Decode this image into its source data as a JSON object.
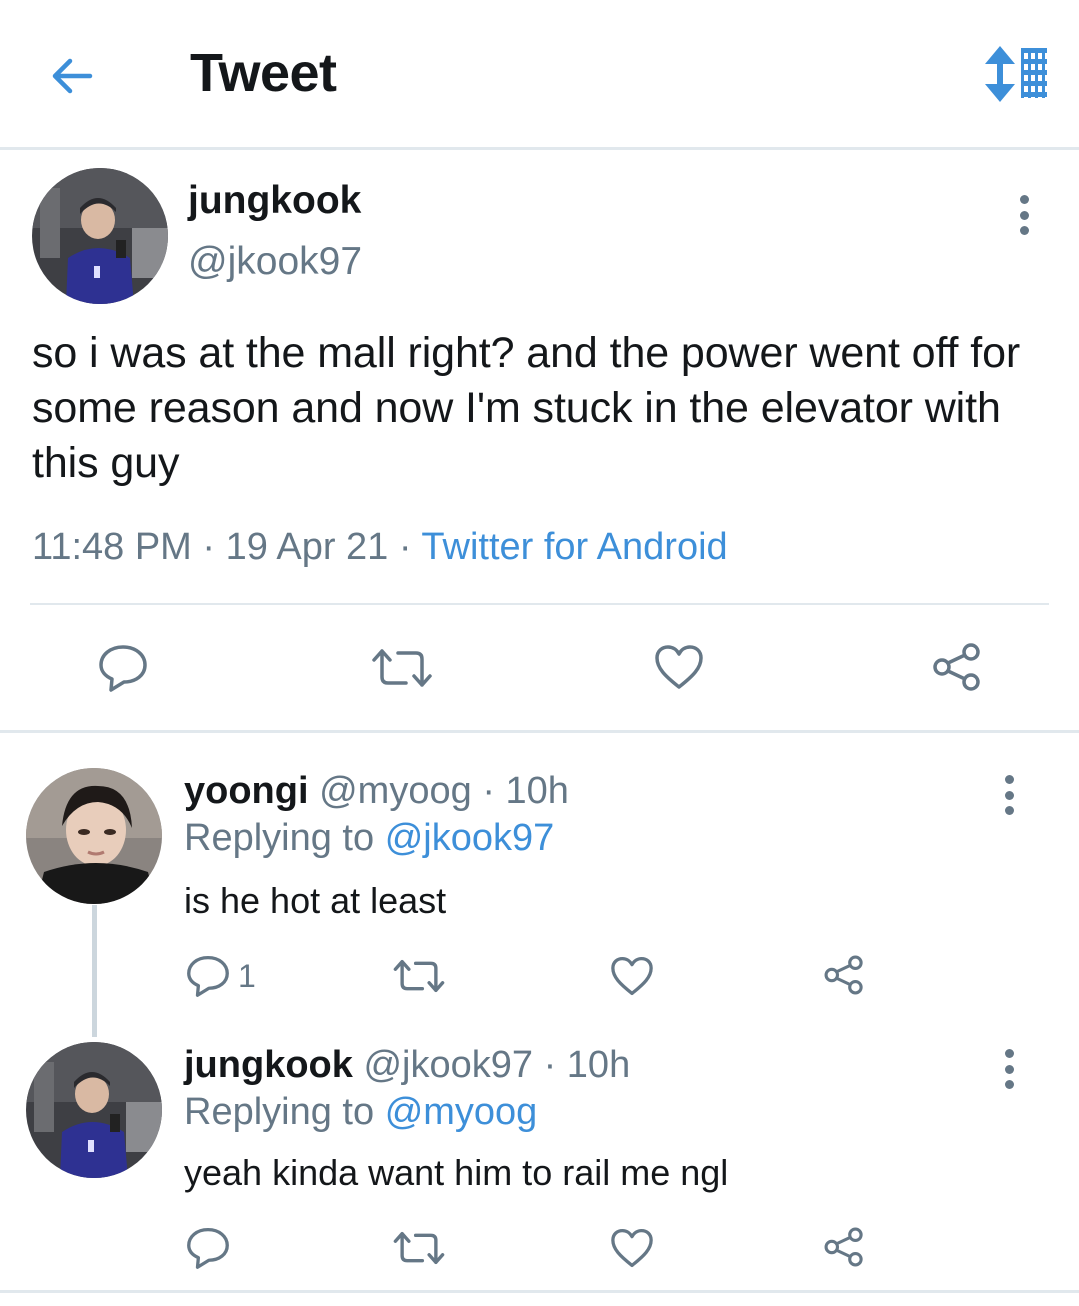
{
  "header": {
    "title": "Tweet",
    "back_icon": "arrow-left-icon",
    "sort_icon": "sort-icon",
    "accent_color": "#3d8fd9"
  },
  "main_tweet": {
    "author_name": "jungkook",
    "author_handle": "@jkook97",
    "text": "so i was at the mall right? and the power went off for some reason and now I'm stuck in the elevator with this guy",
    "time": "11:48 PM",
    "date": "19 Apr 21",
    "source": "Twitter for Android",
    "separator": "·",
    "actions": [
      "reply-icon",
      "retweet-icon",
      "like-icon",
      "share-icon"
    ]
  },
  "replies": [
    {
      "author_name": "yoongi",
      "author_handle": "@myoog",
      "age": "10h",
      "replying_label": "Replying to",
      "replying_to": "@jkook97",
      "text": "is he hot at least",
      "reply_count": "1"
    },
    {
      "author_name": "jungkook",
      "author_handle": "@jkook97",
      "age": "10h",
      "replying_label": "Replying to",
      "replying_to": "@myoog",
      "text": "yeah kinda want him to rail me ngl",
      "reply_count": ""
    }
  ]
}
